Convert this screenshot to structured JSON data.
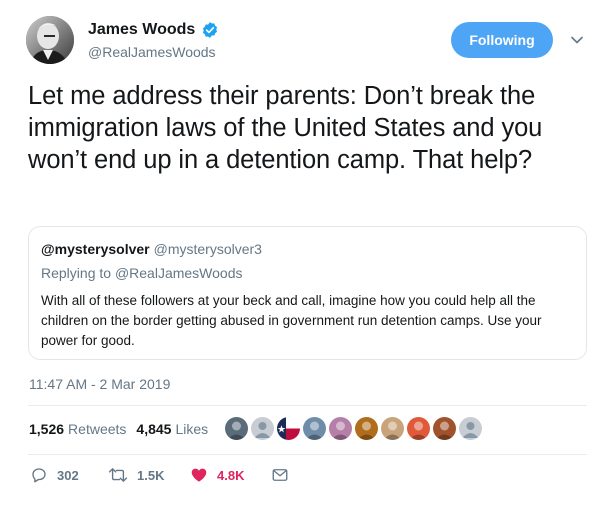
{
  "author": {
    "display_name": "James Woods",
    "handle": "@RealJamesWoods",
    "verified": true,
    "avatar_icon": "profile-photo"
  },
  "follow_button": {
    "label": "Following",
    "color": "#4ea5f5"
  },
  "menu_icon": "chevron-down-icon",
  "tweet": {
    "text": "Let me address their parents: Don’t break the immigration laws of the United States and you won’t end up in a detention camp. That help?"
  },
  "quoted_tweet": {
    "display_name": "@mysterysolver",
    "handle": "@mysterysolver3",
    "replying_label": "Replying to",
    "replying_to": "@RealJamesWoods",
    "text": "With all of these followers at your beck and call, imagine how you could help all the children on the border getting abused in government run detention camps. Use your power for good."
  },
  "timestamp": "11:47 AM - 2 Mar 2019",
  "stats": {
    "retweets_count": "1,526",
    "retweets_label": "Retweets",
    "likes_count": "4,845",
    "likes_label": "Likes"
  },
  "liker_avatars": [
    {
      "icon": "avatar-photo",
      "color": "#5a6b7a"
    },
    {
      "icon": "default-avatar",
      "color": "#c7cdd2"
    },
    {
      "icon": "texas-flag",
      "color": "#1d2a57"
    },
    {
      "icon": "avatar-photo",
      "color": "#6f8da8"
    },
    {
      "icon": "avatar-photo",
      "color": "#b57fa8"
    },
    {
      "icon": "avatar-photo",
      "color": "#b06d1c"
    },
    {
      "icon": "avatar-photo",
      "color": "#c9a37b"
    },
    {
      "icon": "avatar-photo",
      "color": "#e05a3a"
    },
    {
      "icon": "avatar-photo",
      "color": "#a0522d"
    },
    {
      "icon": "default-avatar",
      "color": "#c7cdd2"
    }
  ],
  "actions": {
    "reply_count": "302",
    "retweet_count": "1.5K",
    "like_count": "4.8K",
    "like_color": "#e0245e"
  },
  "colors": {
    "text": "#14171a",
    "secondary": "#657786",
    "border": "#e1e8ed",
    "accent": "#4ea5f5",
    "verified": "#1da1f2"
  }
}
